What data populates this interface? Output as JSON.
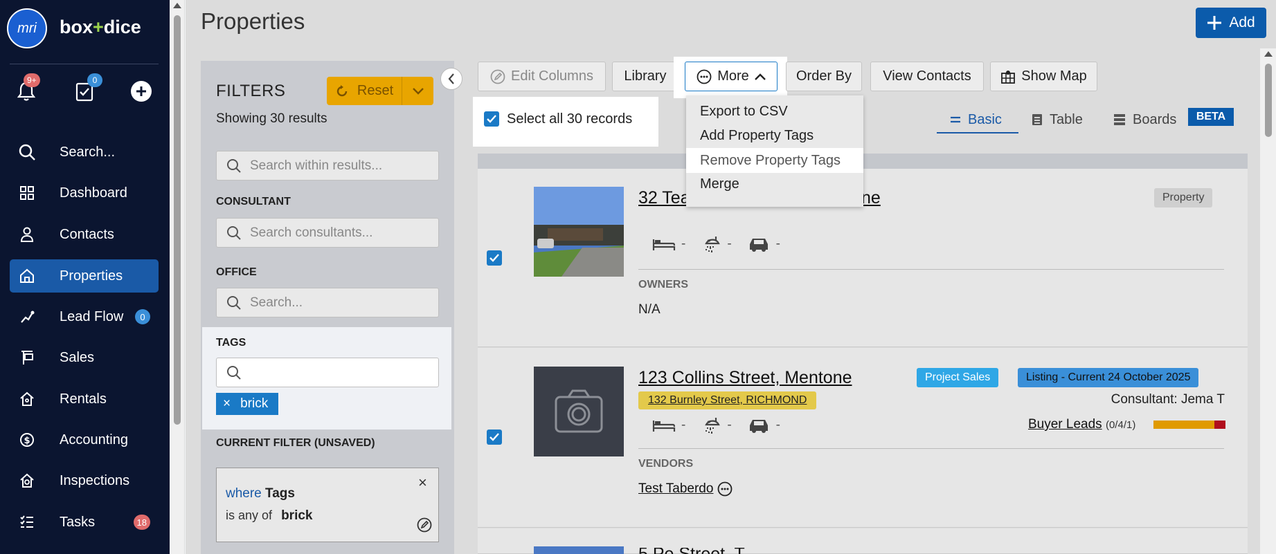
{
  "sidebar": {
    "logo_text": "mri",
    "brand_left": "box",
    "brand_plus": "+",
    "brand_right": "dice",
    "notifications_badge": "9+",
    "tasks_badge": "0",
    "items": [
      {
        "label": "Search...",
        "icon": "search-icon"
      },
      {
        "label": "Dashboard",
        "icon": "grid-icon"
      },
      {
        "label": "Contacts",
        "icon": "person-icon"
      },
      {
        "label": "Properties",
        "icon": "home-icon",
        "active": true
      },
      {
        "label": "Lead Flow",
        "icon": "lead-flow-icon",
        "badge": "0"
      },
      {
        "label": "Sales",
        "icon": "sign-icon"
      },
      {
        "label": "Rentals",
        "icon": "house-key-icon"
      },
      {
        "label": "Accounting",
        "icon": "dollar-icon"
      },
      {
        "label": "Inspections",
        "icon": "inspection-icon"
      },
      {
        "label": "Tasks",
        "icon": "tasks-icon",
        "badge": "18"
      }
    ]
  },
  "header": {
    "title": "Properties",
    "add_label": "Add"
  },
  "filters": {
    "title": "FILTERS",
    "reset_label": "Reset",
    "results_text": "Showing 30 results",
    "search_placeholder": "Search within results...",
    "consultant_label": "CONSULTANT",
    "consultant_placeholder": "Search consultants...",
    "office_label": "OFFICE",
    "office_placeholder": "Search...",
    "tags_label": "TAGS",
    "tag_chip": "brick",
    "tag_chip_remove": "×",
    "current_filter_label": "CURRENT FILTER (UNSAVED)",
    "cf_where": "where",
    "cf_field": "Tags",
    "cf_op": "is any of",
    "cf_value": "brick",
    "cf_close": "×"
  },
  "toolbar": {
    "edit_columns": "Edit Columns",
    "library": "Library",
    "more": "More",
    "order_by": "Order By",
    "view_contacts": "View Contacts",
    "show_map": "Show Map",
    "select_all": "Select all 30 records"
  },
  "more_menu": {
    "items": [
      "Export to CSV",
      "Add Property Tags",
      "Remove Property Tags",
      "Merge"
    ]
  },
  "views": {
    "basic": "Basic",
    "table": "Table",
    "boards": "Boards",
    "beta": "BETA"
  },
  "cards": [
    {
      "title_visible_start": "32 Tea",
      "title_visible_end": "ne",
      "type_badge": "Property",
      "beds": "-",
      "baths": "-",
      "cars": "-",
      "section_label": "OWNERS",
      "section_value": "N/A"
    },
    {
      "title": "123 Collins Street, Mentone",
      "sub_address": "132 Burnley Street, RICHMOND",
      "badge_project": "Project Sales",
      "badge_listing": "Listing - Current 24 October 2025",
      "consultant": "Consultant: Jema T",
      "buyer_leads_label": "Buyer Leads",
      "buyer_leads_count": "(0/4/1)",
      "buyer_leads_fraction": 0.85,
      "beds": "-",
      "baths": "-",
      "cars": "-",
      "section_label": "VENDORS",
      "vendor": "Test Taberdo"
    },
    {
      "title_visible": "5 Pe   Street, T"
    }
  ],
  "colors": {
    "sidebar_bg": "#0b1530",
    "active_blue": "#1a5aa7",
    "reset_orange": "#e8a500",
    "badge_red": "#e06b6b",
    "badge_blue": "#3a8fd8",
    "project_sales": "#2fa7e6",
    "sub_address_yellow": "#e3c94b"
  }
}
